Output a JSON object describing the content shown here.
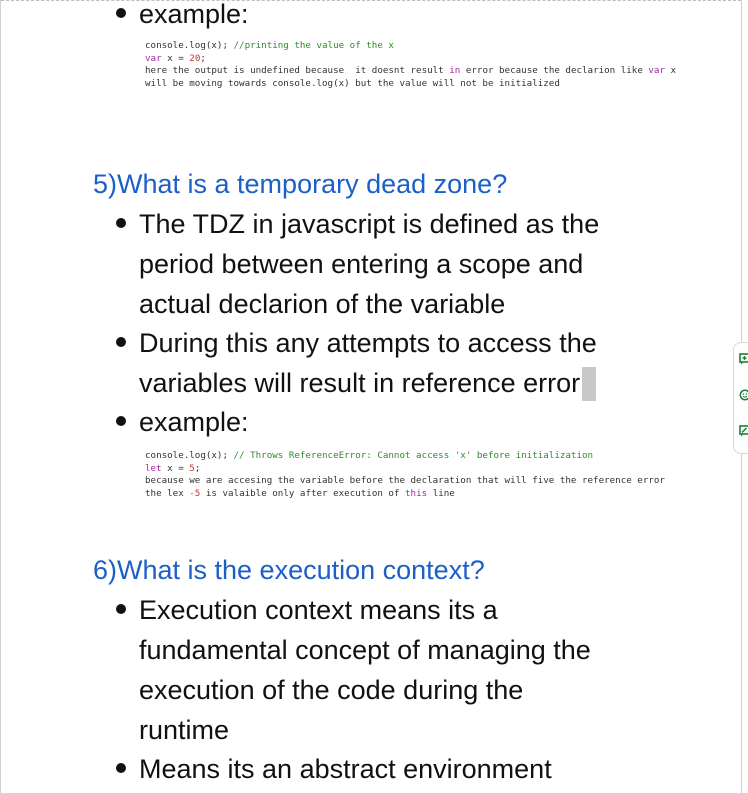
{
  "section4": {
    "bullet_example": "example:",
    "code": {
      "l1_a": "console.log(x); ",
      "l1_comment": "//printing the value of the x",
      "l2_kw": "var",
      "l2_b": " x = ",
      "l2_num": "20",
      "l2_c": ";",
      "l3_a": "here the output is undefined because  it doesnt result ",
      "l3_kw": "in",
      "l3_b": " error because the declarion like ",
      "l3_kw2": "var",
      "l3_c": " x",
      "l4": "will be moving towards console.log(x) but the value will not be initialized"
    }
  },
  "section5": {
    "heading": "5)What is a temporary dead  zone?",
    "bullet1_lines": [
      "The TDZ in javascript is defined as the",
      "period between entering a scope and",
      "actual declarion of the variable"
    ],
    "bullet2_lines": [
      "During this any attempts to access the",
      "variables will result in reference error"
    ],
    "bullet3": "example:",
    "code": {
      "l1_a": "console.log(x); ",
      "l1_comment": "// Throws ReferenceError: Cannot access 'x' before initialization",
      "l2_kw": "let",
      "l2_b": " x = ",
      "l2_num": "5",
      "l2_c": ";",
      "l3": "because we are accesing the variable before the declaration that will five the reference error",
      "l4_a": "the lex ",
      "l4_num": "-5",
      "l4_b": " is valaible only after execution of ",
      "l4_kw": "this",
      "l4_c": " line"
    }
  },
  "section6": {
    "heading": "6)What is the execution context?",
    "bullet1_lines": [
      "Execution context means its a",
      "fundamental concept of managing the",
      "execution of the code during the",
      "runtime"
    ],
    "bullet2": "Means its an abstract environment"
  },
  "side_tools": {
    "icons": [
      "add-comment-icon",
      "emoji-icon",
      "suggest-edit-icon"
    ],
    "accent_color": "#188038"
  }
}
